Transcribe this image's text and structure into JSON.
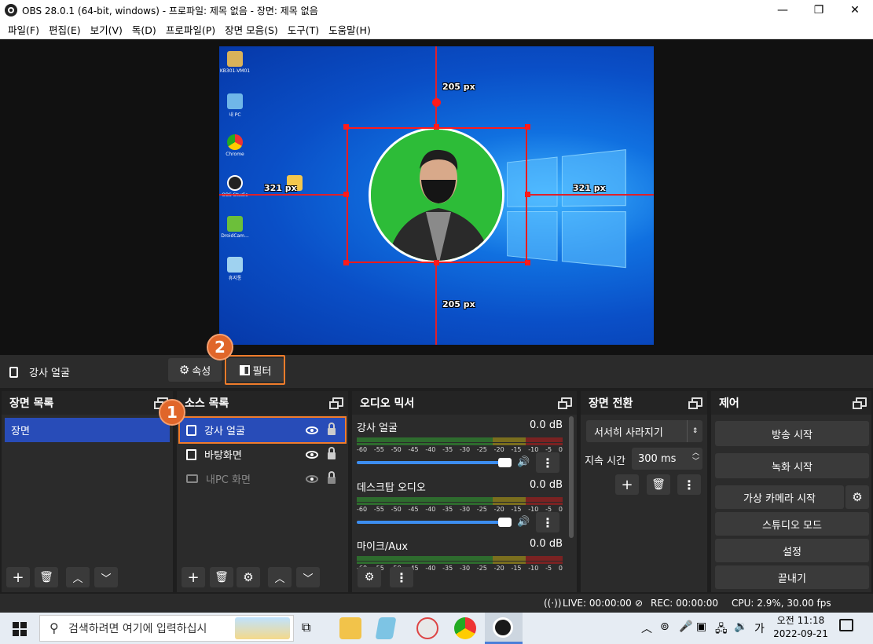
{
  "window": {
    "title": "OBS 28.0.1 (64-bit, windows) - 프로파일: 제목 없음 - 장면: 제목 없음",
    "min": "—",
    "max": "❐",
    "close": "✕"
  },
  "menu": [
    "파일(F)",
    "편집(E)",
    "보기(V)",
    "독(D)",
    "프로파일(P)",
    "장면 모음(S)",
    "도구(T)",
    "도움말(H)"
  ],
  "preview": {
    "desktop_icons": [
      "KB301-VM01",
      "내 PC",
      "Chrome",
      "OBS Studio",
      "",
      "DroidCam...",
      "휴지통"
    ],
    "dist_top": "205 px",
    "dist_bottom": "205 px",
    "dist_left": "321 px",
    "dist_right": "321 px"
  },
  "source_toolbar": {
    "current_source": "강사 얼굴",
    "properties": "속성",
    "filters": "필터",
    "badge_1": "1",
    "badge_2": "2"
  },
  "scenes": {
    "title": "장면 목록",
    "items": [
      "장면"
    ]
  },
  "sources": {
    "title": "소스 목록",
    "items": [
      {
        "name": "강사 얼굴",
        "visible": true
      },
      {
        "name": "바탕화면",
        "visible": true
      },
      {
        "name": "내PC 화면",
        "visible": false
      }
    ]
  },
  "mixer": {
    "title": "오디오 믹서",
    "channels": [
      {
        "name": "강사 얼굴",
        "db": "0.0 dB"
      },
      {
        "name": "데스크탑 오디오",
        "db": "0.0 dB"
      },
      {
        "name": "마이크/Aux",
        "db": "0.0 dB"
      }
    ],
    "ticks": [
      "-60",
      "-55",
      "-50",
      "-45",
      "-40",
      "-35",
      "-30",
      "-25",
      "-20",
      "-15",
      "-10",
      "-5",
      "0"
    ]
  },
  "transitions": {
    "title": "장면 전환",
    "selected": "서서히 사라지기",
    "duration_label": "지속 시간",
    "duration_value": "300 ms"
  },
  "controls": {
    "title": "제어",
    "start_stream": "방송 시작",
    "start_record": "녹화 시작",
    "virtual_cam": "가상 카메라 시작",
    "studio_mode": "스튜디오 모드",
    "settings": "설정",
    "exit": "끝내기"
  },
  "status": {
    "live": "LIVE: 00:00:00",
    "rec": "REC: 00:00:00",
    "cpu": "CPU: 2.9%, 30.00 fps"
  },
  "taskbar": {
    "search_placeholder": "검색하려면 여기에 입력하십시",
    "ime": "가",
    "time": "오전 11:18",
    "date": "2022-09-21"
  }
}
